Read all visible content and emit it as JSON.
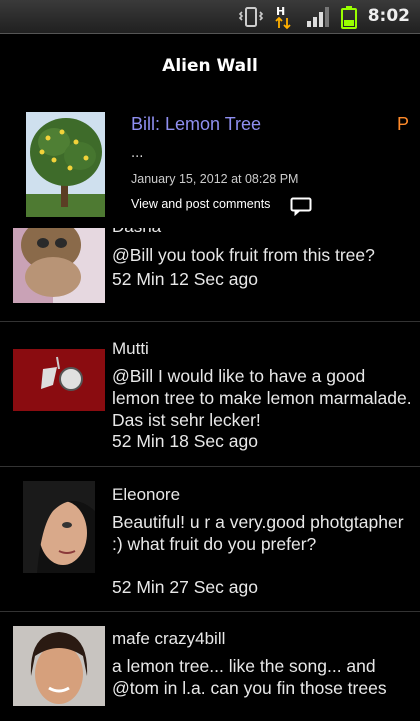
{
  "status_bar": {
    "time": "8:02",
    "network_label": "H",
    "icons": [
      "vibrate-icon",
      "data-transfer-icon",
      "signal-icon",
      "battery-icon"
    ]
  },
  "app": {
    "title": "Alien Wall"
  },
  "post": {
    "title": "Bill: Lemon Tree",
    "corner_letter": "P",
    "body": "...",
    "date": "January 15, 2012 at 08:28 PM",
    "comments_link": "View and post comments"
  },
  "comments": [
    {
      "name": "Dasha",
      "text": "@Bill you  took fruit from this tree?",
      "time": "52 Min 12 Sec ago"
    },
    {
      "name": "Mutti",
      "text": "@Bill I would like to have a good lemon tree to make lemon marmalade. Das ist sehr lecker!",
      "time": "52 Min 18 Sec ago"
    },
    {
      "name": "Eleonore",
      "text": "Beautiful! u r a very.good photgtapher :) what fruit do you prefer?",
      "time": "52 Min 27 Sec ago"
    },
    {
      "name": "mafe crazy4bill",
      "text": "a lemon tree... like the song... and @tom in l.a. can you fin those trees",
      "time": ""
    }
  ],
  "colors": {
    "post_title": "#8f8ff0",
    "corner_letter": "#ff8a2a",
    "background": "#000000",
    "divider": "#333333"
  }
}
